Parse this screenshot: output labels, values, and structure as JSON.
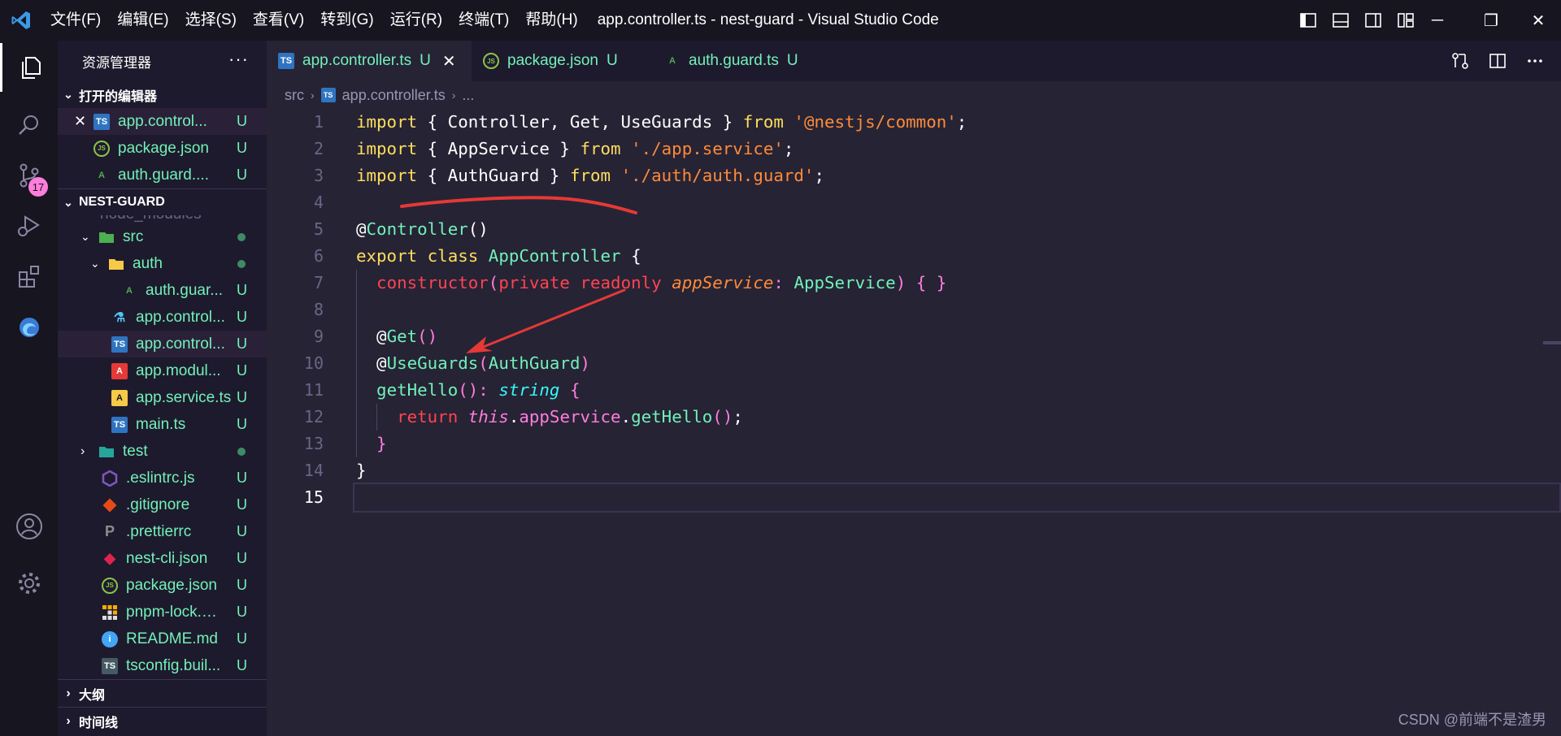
{
  "window": {
    "menu": [
      "文件(F)",
      "编辑(E)",
      "选择(S)",
      "查看(V)",
      "转到(G)",
      "运行(R)",
      "终端(T)",
      "帮助(H)"
    ],
    "title": "app.controller.ts - nest-guard - Visual Studio Code",
    "controls": {
      "minimize": "─",
      "restore": "❐",
      "close": "✕"
    }
  },
  "activity_bar": {
    "items": [
      "explorer-icon",
      "search-icon",
      "source-control-icon",
      "run-debug-icon",
      "extensions-icon",
      "edge-tools-icon"
    ],
    "source_control_badge": "17",
    "bottom": [
      "account-icon",
      "settings-gear-icon"
    ]
  },
  "explorer": {
    "title": "资源管理器",
    "more": "···",
    "open_editors": {
      "label": "打开的编辑器",
      "items": [
        {
          "name": "app.control...",
          "status": "U",
          "icon": "TS",
          "close": "✕"
        },
        {
          "name": "package.json",
          "status": "U",
          "icon": "JS"
        },
        {
          "name": "auth.guard....",
          "status": "U",
          "icon": "A"
        }
      ]
    },
    "project": {
      "label": "NEST-GUARD",
      "items": [
        {
          "name": "node_modules"
        },
        {
          "name": "src"
        },
        {
          "name": "auth"
        },
        {
          "name": "auth.guar...",
          "status": "U"
        },
        {
          "name": "app.control...",
          "status": "U"
        },
        {
          "name": "app.control...",
          "status": "U"
        },
        {
          "name": "app.modul...",
          "status": "U"
        },
        {
          "name": "app.service.ts",
          "status": "U"
        },
        {
          "name": "main.ts",
          "status": "U"
        },
        {
          "name": "test"
        },
        {
          "name": ".eslintrc.js",
          "status": "U"
        },
        {
          "name": ".gitignore",
          "status": "U"
        },
        {
          "name": ".prettierrc",
          "status": "U"
        },
        {
          "name": "nest-cli.json",
          "status": "U"
        },
        {
          "name": "package.json",
          "status": "U"
        },
        {
          "name": "pnpm-lock.y...",
          "status": "U"
        },
        {
          "name": "README.md",
          "status": "U"
        },
        {
          "name": "tsconfig.buil...",
          "status": "U"
        }
      ]
    },
    "outline_label": "大纲",
    "timeline_label": "时间线"
  },
  "tabs": [
    {
      "name": "app.controller.ts",
      "status": "U",
      "close": "✕",
      "icon": "TS"
    },
    {
      "name": "package.json",
      "status": "U",
      "icon": "JS"
    },
    {
      "name": "auth.guard.ts",
      "status": "U",
      "icon": "A"
    }
  ],
  "breadcrumb": {
    "folder": "src",
    "file": "app.controller.ts",
    "rest": "..."
  },
  "code": {
    "line_numbers": [
      "1",
      "2",
      "3",
      "4",
      "5",
      "6",
      "7",
      "8",
      "9",
      "10",
      "11",
      "12",
      "13",
      "14",
      "15"
    ],
    "l1": {
      "k": "import",
      "a": " { Controller, Get, UseGuards } ",
      "f": "from",
      "s": "'@nestjs/common'",
      "e": ";"
    },
    "l2": {
      "k": "import",
      "a": " { AppService } ",
      "f": "from",
      "s": "'./app.service'",
      "e": ";"
    },
    "l3": {
      "k": "import",
      "a": " { AuthGuard } ",
      "f": "from",
      "s": "'./auth/auth.guard'",
      "e": ";"
    },
    "l5": {
      "at": "@",
      "d": "Controller",
      "p": "()"
    },
    "l6": {
      "k1": "export",
      "k2": "class",
      "n": "AppController",
      "b": " {"
    },
    "l7": {
      "c": "constructor",
      "p1": "(",
      "k1": "private",
      "k2": "readonly",
      "v": "appService",
      "colon": ": ",
      "t": "AppService",
      "p2": ")",
      "b": " { }"
    },
    "l9": {
      "at": "@",
      "d": "Get",
      "p": "()"
    },
    "l10": {
      "at": "@",
      "d": "UseGuards",
      "p1": "(",
      "a": "AuthGuard",
      "p2": ")"
    },
    "l11": {
      "f": "getHello",
      "p": "()",
      "colon": ": ",
      "t": "string",
      "b": " {"
    },
    "l12": {
      "r": "return",
      "th": "this",
      "dot1": ".",
      "m": "appService",
      "dot2": ".",
      "f": "getHello",
      "p": "()",
      "e": ";"
    },
    "l13": {
      "b": "}"
    },
    "l14": {
      "b": "}"
    }
  },
  "watermark": "CSDN @前端不是渣男",
  "colors": {
    "annotation": "#e53935",
    "accent": "#72f1b8",
    "editor_bg": "#262335"
  }
}
